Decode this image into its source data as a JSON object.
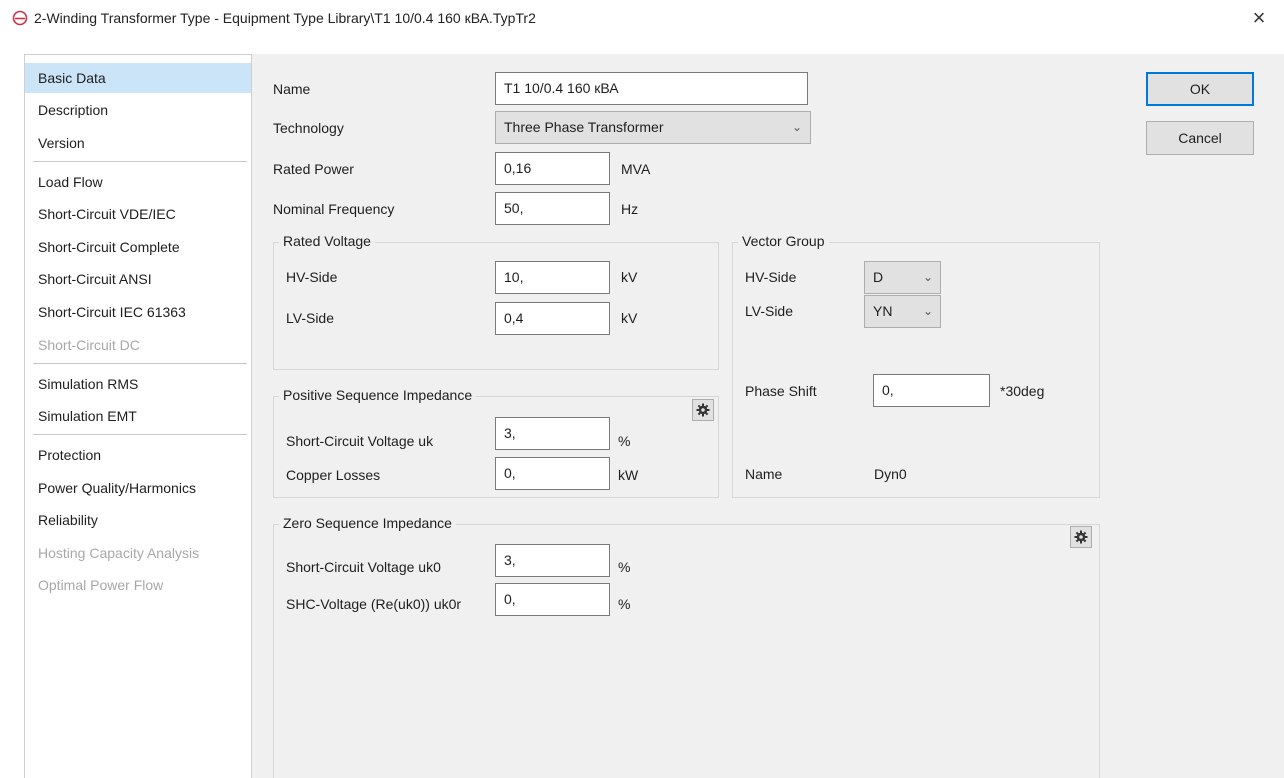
{
  "window": {
    "title": "2-Winding Transformer Type - Equipment Type Library\\T1 10/0.4 160 кВА.TypTr2",
    "close_label": "×",
    "app_icon": "powerfactory-logo-icon"
  },
  "sidebar": {
    "items": [
      {
        "label": "Basic Data",
        "state": "active"
      },
      {
        "label": "Description",
        "state": "normal"
      },
      {
        "label": "Version",
        "state": "normal"
      },
      {
        "label": "Load Flow",
        "state": "normal"
      },
      {
        "label": "Short-Circuit VDE/IEC",
        "state": "normal"
      },
      {
        "label": "Short-Circuit Complete",
        "state": "normal"
      },
      {
        "label": "Short-Circuit ANSI",
        "state": "normal"
      },
      {
        "label": "Short-Circuit IEC 61363",
        "state": "normal"
      },
      {
        "label": "Short-Circuit DC",
        "state": "disabled"
      },
      {
        "label": "Simulation RMS",
        "state": "normal"
      },
      {
        "label": "Simulation EMT",
        "state": "normal"
      },
      {
        "label": "Protection",
        "state": "normal"
      },
      {
        "label": "Power Quality/Harmonics",
        "state": "normal"
      },
      {
        "label": "Reliability",
        "state": "normal"
      },
      {
        "label": "Hosting Capacity Analysis",
        "state": "disabled"
      },
      {
        "label": "Optimal Power Flow",
        "state": "disabled"
      }
    ]
  },
  "basic": {
    "name_label": "Name",
    "name_value": "T1 10/0.4 160 кВА",
    "technology_label": "Technology",
    "technology_value": "Three Phase Transformer",
    "rated_power_label": "Rated Power",
    "rated_power_value": "0,16",
    "rated_power_unit": "MVA",
    "nominal_frequency_label": "Nominal Frequency",
    "nominal_frequency_value": "50,",
    "nominal_frequency_unit": "Hz"
  },
  "rated_voltage": {
    "title": "Rated Voltage",
    "hv_label": "HV-Side",
    "hv_value": "10,",
    "hv_unit": "kV",
    "lv_label": "LV-Side",
    "lv_value": "0,4",
    "lv_unit": "kV"
  },
  "vector_group": {
    "title": "Vector Group",
    "hv_label": "HV-Side",
    "hv_value": "D",
    "lv_label": "LV-Side",
    "lv_value": "YN",
    "phase_shift_label": "Phase Shift",
    "phase_shift_value": "0,",
    "phase_shift_unit": "*30deg",
    "name_label": "Name",
    "name_value": "Dyn0"
  },
  "positive_sequence": {
    "title": "Positive Sequence Impedance",
    "uk_label": "Short-Circuit Voltage uk",
    "uk_value": "3,",
    "uk_unit": "%",
    "copper_label": "Copper Losses",
    "copper_value": "0,",
    "copper_unit": "kW"
  },
  "zero_sequence": {
    "title": "Zero Sequence Impedance",
    "uk0_label": "Short-Circuit Voltage uk0",
    "uk0_value": "3,",
    "uk0_unit": "%",
    "uk0r_label": "SHC-Voltage (Re(uk0)) uk0r",
    "uk0r_value": "0,",
    "uk0r_unit": "%"
  },
  "buttons": {
    "ok": "OK",
    "cancel": "Cancel"
  },
  "colors": {
    "active_nav": "#cce4f7",
    "default_button_border": "#0078d7",
    "vector_group_name": "#1f3a7a"
  }
}
